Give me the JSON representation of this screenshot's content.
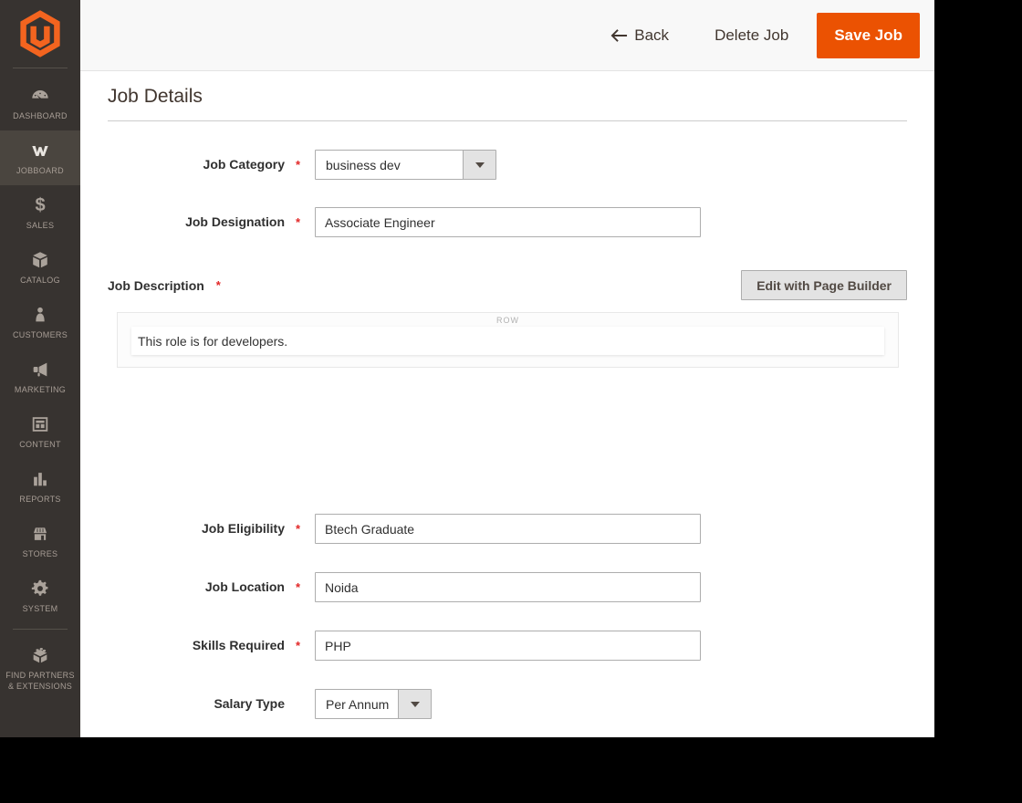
{
  "ui": {
    "required_marker": "*"
  },
  "header": {
    "back_label": "Back",
    "delete_label": "Delete Job",
    "save_label": "Save Job"
  },
  "page": {
    "title": "Job Details"
  },
  "sidebar": {
    "items": [
      {
        "label": "DASHBOARD",
        "icon": "dashboard"
      },
      {
        "label": "JOBBOARD",
        "icon": "jobboard",
        "active": true
      },
      {
        "label": "SALES",
        "icon": "sales",
        "glyph": "$"
      },
      {
        "label": "CATALOG",
        "icon": "catalog"
      },
      {
        "label": "CUSTOMERS",
        "icon": "customers"
      },
      {
        "label": "MARKETING",
        "icon": "marketing"
      },
      {
        "label": "CONTENT",
        "icon": "content"
      },
      {
        "label": "REPORTS",
        "icon": "reports"
      },
      {
        "label": "STORES",
        "icon": "stores"
      },
      {
        "label": "SYSTEM",
        "icon": "system"
      },
      {
        "label": "FIND PARTNERS & EXTENSIONS",
        "icon": "find-partners"
      }
    ]
  },
  "form": {
    "job_category": {
      "label": "Job Category",
      "required": true,
      "value": "business dev"
    },
    "job_designation": {
      "label": "Job Designation",
      "required": true,
      "value": "Associate Engineer"
    },
    "job_description": {
      "label": "Job Description",
      "required": true,
      "edit_button": "Edit with Page Builder",
      "row_tag": "ROW",
      "content": "This role is for developers."
    },
    "job_eligibility": {
      "label": "Job Eligibility",
      "required": true,
      "value": "Btech Graduate"
    },
    "job_location": {
      "label": "Job Location",
      "required": true,
      "value": "Noida"
    },
    "skills_required": {
      "label": "Skills Required",
      "required": true,
      "value": "PHP"
    },
    "salary_type": {
      "label": "Salary Type",
      "required": false,
      "value": "Per Annum"
    }
  },
  "colors": {
    "accent": "#eb5202",
    "sidebar_bg": "#373330",
    "sidebar_active_bg": "#4a453f",
    "required": "#e22626",
    "header_bg": "#f8f8f8"
  }
}
